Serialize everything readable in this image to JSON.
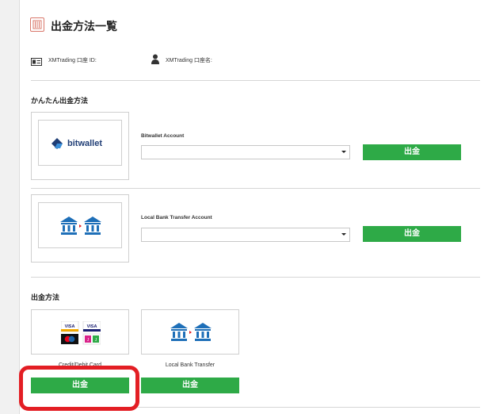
{
  "header": {
    "title": "出金方法一覧",
    "account_id_label": "XMTrading 口座 ID:",
    "account_name_label": "XMTrading 口座名:"
  },
  "easy_section": {
    "title": "かんたん出金方法",
    "methods": [
      {
        "logo_text": "bitwallet",
        "field_label": "Bitwallet Account",
        "select_value": "",
        "button_label": "出金"
      },
      {
        "logo_text": "",
        "field_label": "Local Bank Transfer Account",
        "select_value": "",
        "button_label": "出金"
      }
    ]
  },
  "methods_section": {
    "title": "出金方法",
    "cards": [
      {
        "caption": "Credit/Debit Card",
        "button_label": "出金"
      },
      {
        "caption": "Local Bank Transfer",
        "button_label": "出金"
      }
    ]
  },
  "colors": {
    "button_green": "#2eaa47",
    "highlight_red": "#e31e24",
    "bank_blue": "#1e6fb8",
    "bitwallet_navy": "#1f3d75"
  }
}
